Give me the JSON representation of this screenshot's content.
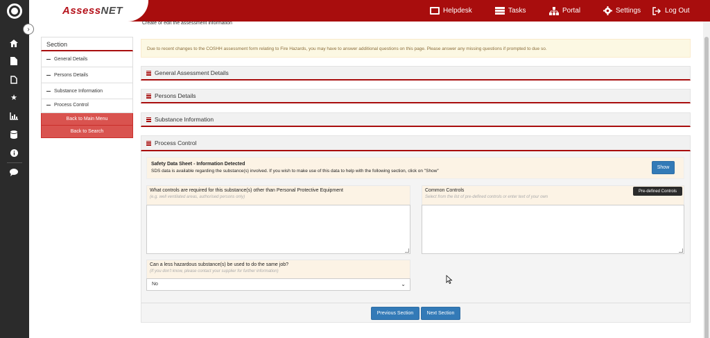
{
  "app": {
    "brand_prefix": "Assess",
    "brand_suffix": "NET"
  },
  "topnav": [
    {
      "label": "Helpdesk",
      "icon": "helpdesk-icon"
    },
    {
      "label": "Tasks",
      "icon": "tasks-icon"
    },
    {
      "label": "Portal",
      "icon": "portal-icon"
    },
    {
      "label": "Settings",
      "icon": "settings-icon"
    },
    {
      "label": "Log Out",
      "icon": "logout-icon"
    }
  ],
  "page": {
    "subtitle": "Create or edit the assessment information"
  },
  "sidebar": {
    "title": "Section",
    "items": [
      {
        "label": "General Details"
      },
      {
        "label": "Persons Details"
      },
      {
        "label": "Substance Information"
      },
      {
        "label": "Process Control"
      }
    ],
    "back_main": "Back to Main Menu",
    "back_search": "Back to Search"
  },
  "alert": {
    "text": "Due to recent changes to the COSHH assessment form relating to Fire Hazards, you may have to answer additional questions on this page. Please answer any missing questions if prompted to due so."
  },
  "panels": [
    {
      "title": "General Assessment Details"
    },
    {
      "title": "Persons Details"
    },
    {
      "title": "Substance Information"
    },
    {
      "title": "Process Control"
    }
  ],
  "sds": {
    "title": "Safety Data Sheet - Information Detected",
    "text": "SDS data is available regarding the substance(s) involved. If you wish to make use of this data to help with the following section, click on \"Show\"",
    "show_label": "Show"
  },
  "controls_question": {
    "label": "What controls are required for this substance(s) other than Personal Protective Equipment",
    "hint": "(e.g. well ventilated areas, authorised persons only)",
    "value": ""
  },
  "common_controls": {
    "label": "Common Controls",
    "hint": "Select from the list of pre-defined controls or enter text of your own",
    "button_label": "Pre-defined Controls",
    "value": ""
  },
  "substitute_question": {
    "label": "Can a less hazardous substance(s) be used to do the same job?",
    "hint": "(If you don't know, please contact your supplier for further information)",
    "selected": "No"
  },
  "footer": {
    "prev_label": "Previous Section",
    "next_label": "Next Section"
  },
  "colors": {
    "brand_red": "#a80d0d",
    "rail_dark": "#2b2b2b",
    "button_blue": "#337ab7",
    "back_button_red": "#d9534f"
  }
}
